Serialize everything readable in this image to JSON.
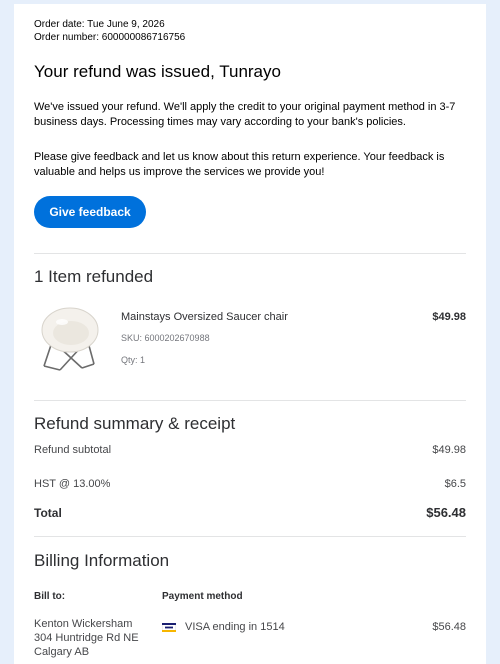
{
  "order": {
    "date_line": "Order date: Tue June 9, 2026",
    "number_line": "Order number: 600000086716756"
  },
  "title": "Your refund was issued, Tunrayo",
  "paragraphs": {
    "refund_info": "We've issued your refund. We'll apply the credit to your original payment method in 3-7 business days. Processing times may vary according to your bank's policies.",
    "feedback_request": "Please give feedback and let us know about this return experience. Your feedback is valuable and helps us improve the services we provide you!"
  },
  "feedback_button": "Give feedback",
  "items_section": {
    "heading": "1 Item refunded",
    "items": [
      {
        "name": "Mainstays Oversized Saucer chair",
        "price": "$49.98",
        "sku": "SKU: 6000202670988",
        "qty": "Qty: 1"
      }
    ]
  },
  "summary": {
    "heading": "Refund summary & receipt",
    "subtotal_label": "Refund subtotal",
    "subtotal_value": "$49.98",
    "tax_label": "HST @ 13.00%",
    "tax_value": "$6.5",
    "total_label": "Total",
    "total_value": "$56.48"
  },
  "billing": {
    "heading": "Billing Information",
    "bill_to_label": "Bill to:",
    "payment_method_label": "Payment method",
    "address_lines": [
      "Kenton Wickersham",
      "304 Huntridge Rd NE",
      "Calgary AB"
    ],
    "payment_text": "VISA ending in 1514",
    "payment_amount": "$56.48",
    "payment_icon": "visa-card-icon"
  },
  "colors": {
    "accent": "#0071dc",
    "background": "#e6effb"
  }
}
